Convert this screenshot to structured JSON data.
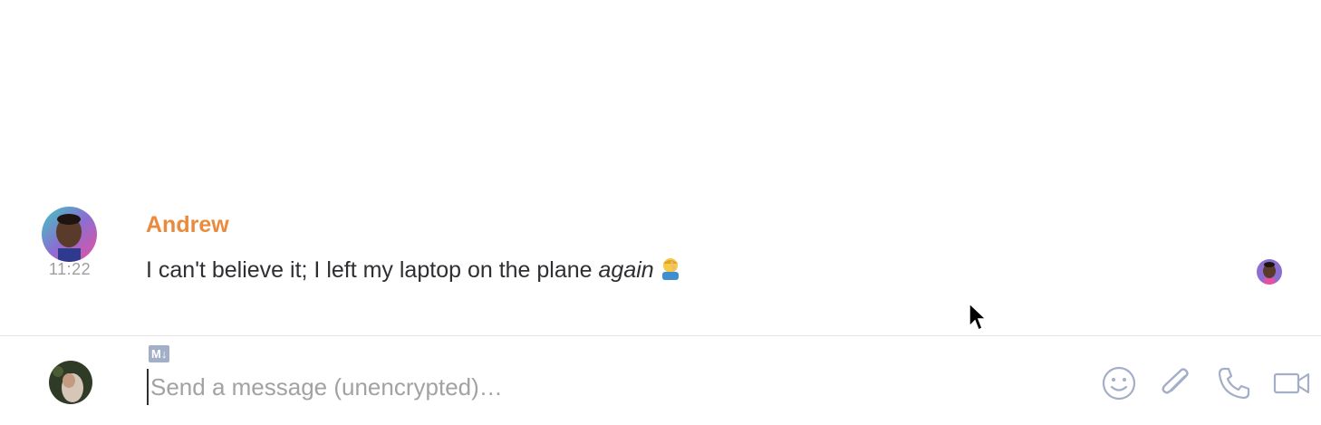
{
  "message": {
    "sender_name": "Andrew",
    "timestamp": "11:22",
    "body_text": "I can't believe it; I left my laptop on the plane ",
    "body_emphasis": "again",
    "body_emoji": "facepalm-emoji"
  },
  "composer": {
    "markdown_badge": "M↓",
    "placeholder": "Send a message (unencrypted)…",
    "buttons": [
      "emoji-button",
      "attachment-button",
      "voice-call-button",
      "video-call-button"
    ]
  },
  "colors": {
    "sender_name": "#e98a3c",
    "text": "#2e2f32",
    "icon": "#a3aec7",
    "divider": "#e3e3e3"
  }
}
